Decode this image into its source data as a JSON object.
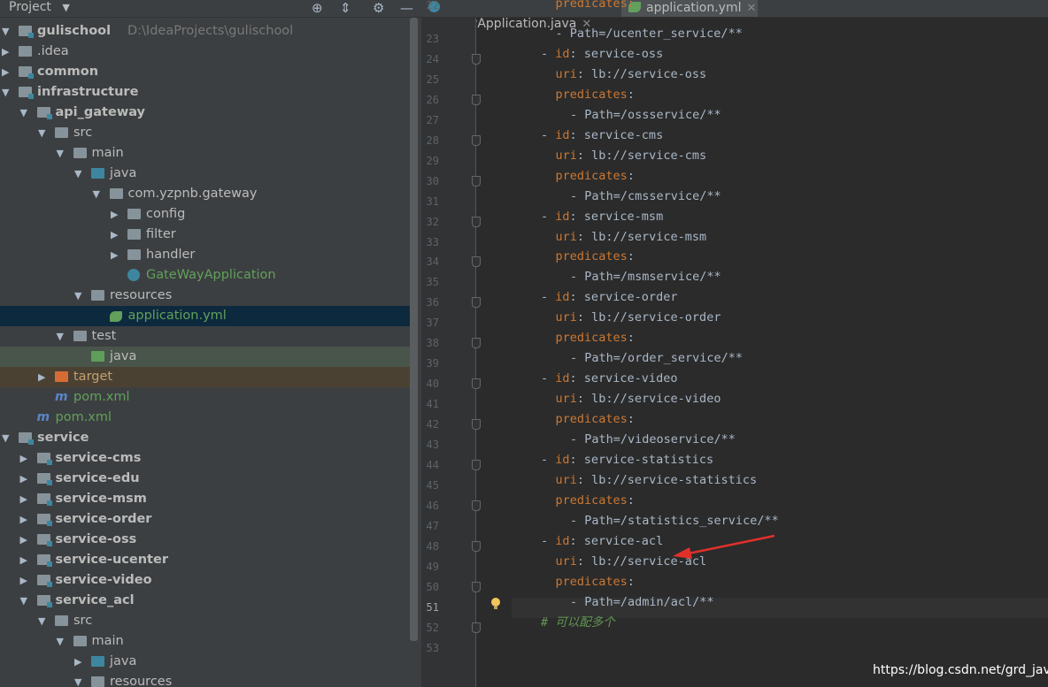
{
  "project_panel": {
    "header_title": "Project",
    "header_icons": [
      "target-icon",
      "collapse-icon",
      "gear-icon",
      "minimize-icon"
    ],
    "tree": [
      {
        "label": "gulischool",
        "path": "D:\\IdeaProjects\\gulischool",
        "bold": true,
        "depth": 0,
        "expanded": true,
        "icon": "module-folder"
      },
      {
        "label": ".idea",
        "depth": 0,
        "expanded": false,
        "icon": "folder"
      },
      {
        "label": "common",
        "bold": true,
        "depth": 0,
        "expanded": false,
        "icon": "module-folder"
      },
      {
        "label": "infrastructure",
        "bold": true,
        "depth": 0,
        "expanded": true,
        "icon": "module-folder"
      },
      {
        "label": "api_gateway",
        "bold": true,
        "depth": 1,
        "expanded": true,
        "icon": "module-folder"
      },
      {
        "label": "src",
        "depth": 2,
        "expanded": true,
        "icon": "folder"
      },
      {
        "label": "main",
        "depth": 3,
        "expanded": true,
        "icon": "folder"
      },
      {
        "label": "java",
        "depth": 4,
        "expanded": true,
        "icon": "source-folder"
      },
      {
        "label": "com.yzpnb.gateway",
        "depth": 5,
        "expanded": true,
        "icon": "package"
      },
      {
        "label": "config",
        "depth": 6,
        "expanded": false,
        "icon": "package"
      },
      {
        "label": "filter",
        "depth": 6,
        "expanded": false,
        "icon": "package"
      },
      {
        "label": "handler",
        "depth": 6,
        "expanded": false,
        "icon": "package"
      },
      {
        "label": "GateWayApplication",
        "depth": 6,
        "icon": "spring-class",
        "color": "green"
      },
      {
        "label": "resources",
        "depth": 4,
        "expanded": true,
        "icon": "resources-folder"
      },
      {
        "label": "application.yml",
        "depth": 5,
        "icon": "yml-file",
        "color": "green",
        "selected": true
      },
      {
        "label": "test",
        "depth": 3,
        "expanded": true,
        "icon": "folder"
      },
      {
        "label": "java",
        "depth": 4,
        "icon": "test-folder",
        "highlight": "test"
      },
      {
        "label": "target",
        "depth": 2,
        "expanded": false,
        "icon": "excluded-folder",
        "highlight": "excluded"
      },
      {
        "label": "pom.xml",
        "depth": 2,
        "icon": "maven-file",
        "color": "green"
      },
      {
        "label": "pom.xml",
        "depth": 1,
        "icon": "maven-file",
        "color": "green"
      },
      {
        "label": "service",
        "bold": true,
        "depth": 0,
        "expanded": true,
        "icon": "module-folder"
      },
      {
        "label": "service-cms",
        "bold": true,
        "depth": 1,
        "expanded": false,
        "icon": "module-folder"
      },
      {
        "label": "service-edu",
        "bold": true,
        "depth": 1,
        "expanded": false,
        "icon": "module-folder"
      },
      {
        "label": "service-msm",
        "bold": true,
        "depth": 1,
        "expanded": false,
        "icon": "module-folder"
      },
      {
        "label": "service-order",
        "bold": true,
        "depth": 1,
        "expanded": false,
        "icon": "module-folder"
      },
      {
        "label": "service-oss",
        "bold": true,
        "depth": 1,
        "expanded": false,
        "icon": "module-folder"
      },
      {
        "label": "service-ucenter",
        "bold": true,
        "depth": 1,
        "expanded": false,
        "icon": "module-folder"
      },
      {
        "label": "service-video",
        "bold": true,
        "depth": 1,
        "expanded": false,
        "icon": "module-folder"
      },
      {
        "label": "service_acl",
        "bold": true,
        "depth": 1,
        "expanded": true,
        "icon": "module-folder"
      },
      {
        "label": "src",
        "depth": 2,
        "expanded": true,
        "icon": "folder"
      },
      {
        "label": "main",
        "depth": 3,
        "expanded": true,
        "icon": "folder"
      },
      {
        "label": "java",
        "depth": 4,
        "expanded": false,
        "icon": "source-folder"
      },
      {
        "label": "resources",
        "depth": 4,
        "expanded": true,
        "icon": "resources-folder"
      }
    ]
  },
  "tabs": [
    {
      "label": "GateWayApplication.java",
      "icon": "spring-class",
      "active": false
    },
    {
      "label": "application.yml",
      "icon": "yml-file",
      "active": true
    }
  ],
  "editor": {
    "first_line_partial": {
      "number": "22",
      "text": "predicates:"
    },
    "current_line": "51",
    "lines": [
      {
        "number": "23",
        "indent": 3,
        "parts": [
          {
            "t": "- Path=/ucenter_service/**",
            "c": "v"
          }
        ]
      },
      {
        "number": "24",
        "indent": 2,
        "parts": [
          {
            "t": "- ",
            "c": "v"
          },
          {
            "t": "id",
            "c": "k"
          },
          {
            "t": ": service-oss",
            "c": "v"
          }
        ]
      },
      {
        "number": "25",
        "indent": 3,
        "parts": [
          {
            "t": "uri",
            "c": "k"
          },
          {
            "t": ": lb://service-oss",
            "c": "v"
          }
        ]
      },
      {
        "number": "26",
        "indent": 3,
        "parts": [
          {
            "t": "predicates",
            "c": "k"
          },
          {
            "t": ":",
            "c": "v"
          }
        ]
      },
      {
        "number": "27",
        "indent": 4,
        "parts": [
          {
            "t": "- Path=/ossservice/**",
            "c": "v"
          }
        ]
      },
      {
        "number": "28",
        "indent": 2,
        "parts": [
          {
            "t": "- ",
            "c": "v"
          },
          {
            "t": "id",
            "c": "k"
          },
          {
            "t": ": service-cms",
            "c": "v"
          }
        ]
      },
      {
        "number": "29",
        "indent": 3,
        "parts": [
          {
            "t": "uri",
            "c": "k"
          },
          {
            "t": ": lb://service-cms",
            "c": "v"
          }
        ]
      },
      {
        "number": "30",
        "indent": 3,
        "parts": [
          {
            "t": "predicates",
            "c": "k"
          },
          {
            "t": ":",
            "c": "v"
          }
        ]
      },
      {
        "number": "31",
        "indent": 4,
        "parts": [
          {
            "t": "- Path=/cmsservice/**",
            "c": "v"
          }
        ]
      },
      {
        "number": "32",
        "indent": 2,
        "parts": [
          {
            "t": "- ",
            "c": "v"
          },
          {
            "t": "id",
            "c": "k"
          },
          {
            "t": ": service-msm",
            "c": "v"
          }
        ]
      },
      {
        "number": "33",
        "indent": 3,
        "parts": [
          {
            "t": "uri",
            "c": "k"
          },
          {
            "t": ": lb://service-msm",
            "c": "v"
          }
        ]
      },
      {
        "number": "34",
        "indent": 3,
        "parts": [
          {
            "t": "predicates",
            "c": "k"
          },
          {
            "t": ":",
            "c": "v"
          }
        ]
      },
      {
        "number": "35",
        "indent": 4,
        "parts": [
          {
            "t": "- Path=/msmservice/**",
            "c": "v"
          }
        ]
      },
      {
        "number": "36",
        "indent": 2,
        "parts": [
          {
            "t": "- ",
            "c": "v"
          },
          {
            "t": "id",
            "c": "k"
          },
          {
            "t": ": service-order",
            "c": "v"
          }
        ]
      },
      {
        "number": "37",
        "indent": 3,
        "parts": [
          {
            "t": "uri",
            "c": "k"
          },
          {
            "t": ": lb://service-order",
            "c": "v"
          }
        ]
      },
      {
        "number": "38",
        "indent": 3,
        "parts": [
          {
            "t": "predicates",
            "c": "k"
          },
          {
            "t": ":",
            "c": "v"
          }
        ]
      },
      {
        "number": "39",
        "indent": 4,
        "parts": [
          {
            "t": "- Path=/order_service/**",
            "c": "v"
          }
        ]
      },
      {
        "number": "40",
        "indent": 2,
        "parts": [
          {
            "t": "- ",
            "c": "v"
          },
          {
            "t": "id",
            "c": "k"
          },
          {
            "t": ": service-video",
            "c": "v"
          }
        ]
      },
      {
        "number": "41",
        "indent": 3,
        "parts": [
          {
            "t": "uri",
            "c": "k"
          },
          {
            "t": ": lb://service-video",
            "c": "v"
          }
        ]
      },
      {
        "number": "42",
        "indent": 3,
        "parts": [
          {
            "t": "predicates",
            "c": "k"
          },
          {
            "t": ":",
            "c": "v"
          }
        ]
      },
      {
        "number": "43",
        "indent": 4,
        "parts": [
          {
            "t": "- Path=/videoservice/**",
            "c": "v"
          }
        ]
      },
      {
        "number": "44",
        "indent": 2,
        "parts": [
          {
            "t": "- ",
            "c": "v"
          },
          {
            "t": "id",
            "c": "k"
          },
          {
            "t": ": service-statistics",
            "c": "v"
          }
        ]
      },
      {
        "number": "45",
        "indent": 3,
        "parts": [
          {
            "t": "uri",
            "c": "k"
          },
          {
            "t": ": lb://service-statistics",
            "c": "v"
          }
        ]
      },
      {
        "number": "46",
        "indent": 3,
        "parts": [
          {
            "t": "predicates",
            "c": "k"
          },
          {
            "t": ":",
            "c": "v"
          }
        ]
      },
      {
        "number": "47",
        "indent": 4,
        "parts": [
          {
            "t": "- Path=/statistics_service/**",
            "c": "v"
          }
        ]
      },
      {
        "number": "48",
        "indent": 2,
        "parts": [
          {
            "t": "- ",
            "c": "v"
          },
          {
            "t": "id",
            "c": "k"
          },
          {
            "t": ": service-acl",
            "c": "v"
          }
        ]
      },
      {
        "number": "49",
        "indent": 3,
        "parts": [
          {
            "t": "uri",
            "c": "k"
          },
          {
            "t": ": lb://service-acl",
            "c": "v"
          }
        ]
      },
      {
        "number": "50",
        "indent": 3,
        "parts": [
          {
            "t": "predicates",
            "c": "k"
          },
          {
            "t": ":",
            "c": "v"
          }
        ]
      },
      {
        "number": "51",
        "indent": 4,
        "parts": [
          {
            "t": "- Path=/admin/acl/**",
            "c": "v"
          }
        ]
      },
      {
        "number": "52",
        "indent": 2,
        "parts": [
          {
            "t": "# 可以配多个",
            "c": "cm"
          }
        ]
      },
      {
        "number": "53",
        "indent": 0,
        "parts": []
      }
    ]
  },
  "annotation": {
    "description": "red-arrow-pointing-to-line-48",
    "color": "#e0302a"
  },
  "watermark": "https://blog.csdn.net/grd_java",
  "colors": {
    "keyword": "#cc7832",
    "value": "#a9b7c6",
    "comment": "#629755",
    "green_file": "#62a05b",
    "selection": "#0d293e"
  }
}
